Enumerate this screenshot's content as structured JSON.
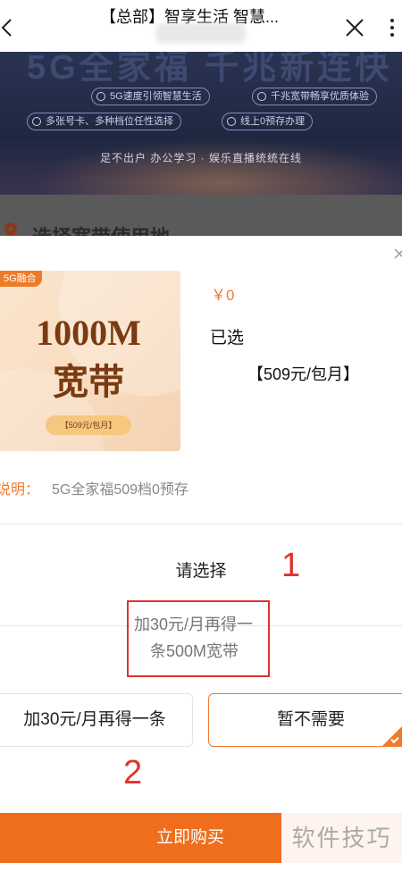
{
  "topbar": {
    "title": "【总部】智享生活 智慧..."
  },
  "banner": {
    "headline": "5G全家福 千兆新连快",
    "features": [
      "5G速度引领智慧生活",
      "千兆宽带畅享优质体验",
      "多张号卡、多种档位任性选择",
      "线上0预存办理"
    ],
    "slogan": "足不出户 办公学习 · 娱乐直播统统在线"
  },
  "section": {
    "title": "选择宽带使用地"
  },
  "product": {
    "tag": "5G融合",
    "speed": "1000M",
    "name": "宽带",
    "price_tag": "【509元/包月】",
    "price": "￥0",
    "selected_label": "已选",
    "selected_plan": "【509元/包月】",
    "desc_label": "说明：",
    "desc_text": "5G全家福509档0预存"
  },
  "options": {
    "prompt": "请选择",
    "hint_line1": "加30元/月再得一",
    "hint_line2": "条500M宽带",
    "option_a": "加30元/月再得一条",
    "option_b": "暂不需要",
    "selected": "暂不需要"
  },
  "annotations": {
    "one": "1",
    "two": "2"
  },
  "footer": {
    "buy_label": "立即购买",
    "watermark": "软件技巧"
  },
  "colors": {
    "accent": "#ef7b2a",
    "annotation": "#e0332b",
    "banner_bg": "#1f2740"
  }
}
